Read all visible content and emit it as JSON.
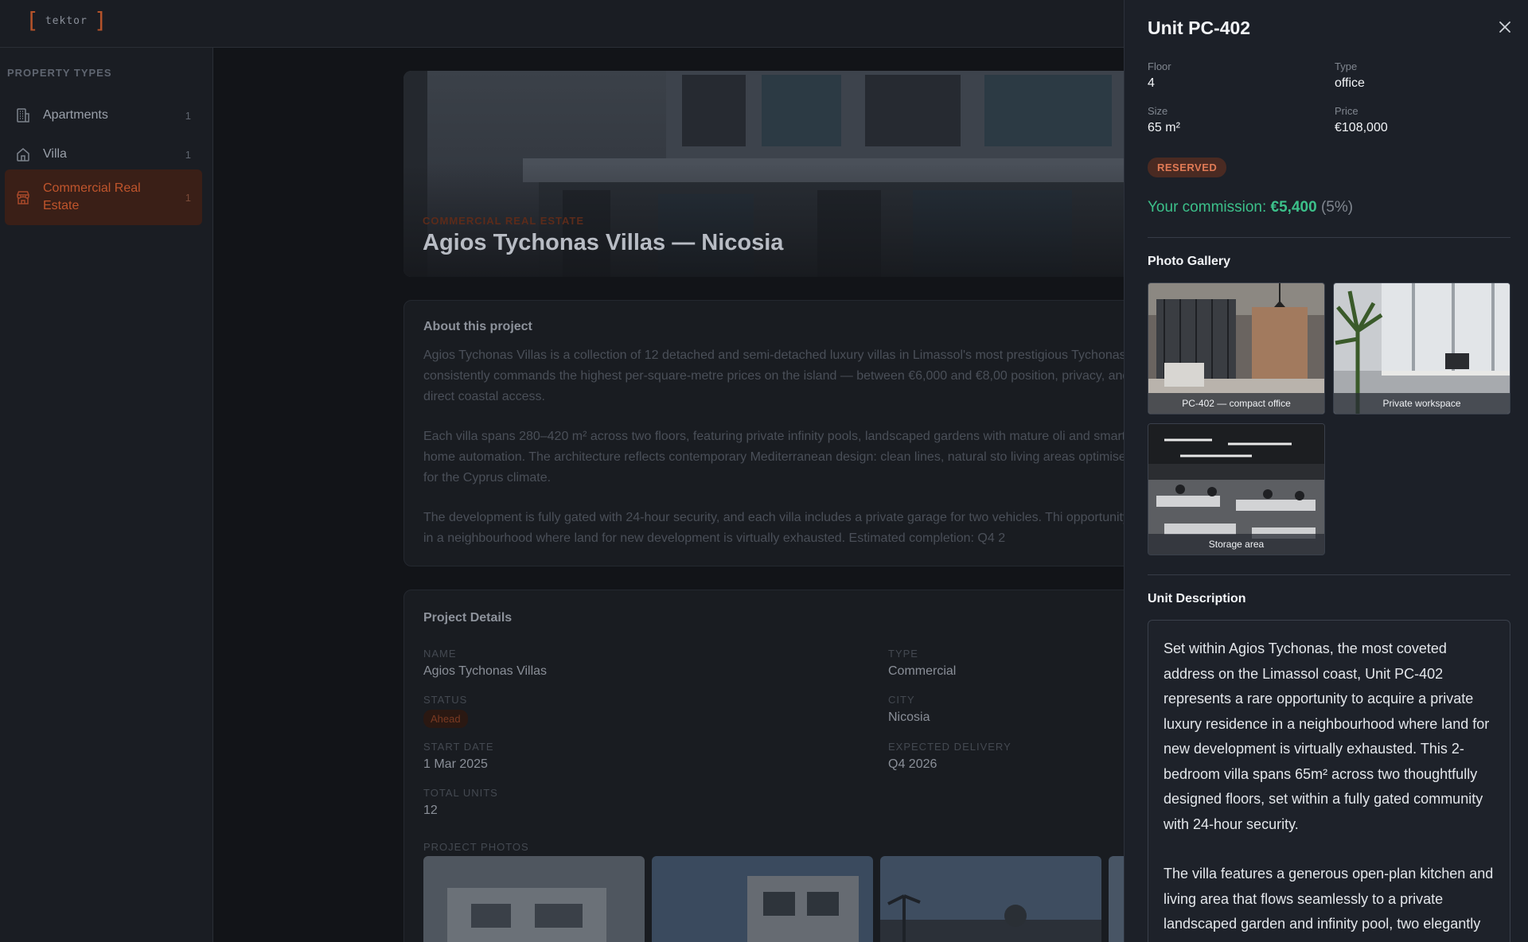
{
  "app": {
    "logo_text": "tektor"
  },
  "sidebar": {
    "title": "PROPERTY TYPES",
    "items": [
      {
        "label": "Apartments",
        "count": "1",
        "icon": "building-icon"
      },
      {
        "label": "Villa",
        "count": "1",
        "icon": "home-icon"
      },
      {
        "label": "Commercial Real Estate",
        "count": "1",
        "icon": "store-icon",
        "active": true
      }
    ]
  },
  "hero": {
    "category": "COMMERCIAL REAL ESTATE",
    "title": "Agios Tychonas Villas — Nicosia"
  },
  "about": {
    "title": "About this project",
    "paragraphs": [
      "Agios Tychonas Villas is a collection of 12 detached and semi-detached luxury villas in Limassol's most prestigious Tychonas consistently commands the highest per-square-metre prices on the island — between €6,000 and €8,00 position, privacy, and direct coastal access.",
      "Each villa spans 280–420 m² across two floors, featuring private infinity pools, landscaped gardens with mature oli and smart home automation. The architecture reflects contemporary Mediterranean design: clean lines, natural sto living areas optimised for the Cyprus climate.",
      "The development is fully gated with 24-hour security, and each villa includes a private garage for two vehicles. Thi opportunity in a neighbourhood where land for new development is virtually exhausted. Estimated completion: Q4 2"
    ]
  },
  "details": {
    "title": "Project Details",
    "name_label": "NAME",
    "name": "Agios Tychonas Villas",
    "type_label": "TYPE",
    "type": "Commercial",
    "status_label": "STATUS",
    "status": "Ahead",
    "city_label": "CITY",
    "city": "Nicosia",
    "start_label": "START DATE",
    "start": "1 Mar 2025",
    "delivery_label": "EXPECTED DELIVERY",
    "delivery": "Q4 2026",
    "units_label": "TOTAL UNITS",
    "units": "12",
    "photos_label": "PROJECT PHOTOS"
  },
  "drawer": {
    "title": "Unit PC-402",
    "floor_label": "Floor",
    "floor": "4",
    "type_label": "Type",
    "type": "office",
    "size_label": "Size",
    "size": "65 m²",
    "price_label": "Price",
    "price": "€108,000",
    "status_badge": "RESERVED",
    "commission_label": "Your commission:",
    "commission_value": "€5,400",
    "commission_pct": "(5%)",
    "gallery_title": "Photo Gallery",
    "gallery": [
      {
        "caption": "PC-402 — compact office"
      },
      {
        "caption": "Private workspace"
      },
      {
        "caption": "Storage area"
      }
    ],
    "description_title": "Unit Description",
    "description": [
      "Set within Agios Tychonas, the most coveted address on the Limassol coast, Unit PC-402 represents a rare opportunity to acquire a private luxury residence in a neighbourhood where land for new development is virtually exhausted. This 2-bedroom villa spans 65m² across two thoughtfully designed floors, set within a fully gated community with 24-hour security.",
      "The villa features a generous open-plan kitchen and living area that flows seamlessly to a private landscaped garden and infinity pool, two elegantly"
    ]
  },
  "colors": {
    "accent": "#c0552c",
    "commission": "#3cc08a",
    "reserved_bg": "#4a2a22"
  }
}
